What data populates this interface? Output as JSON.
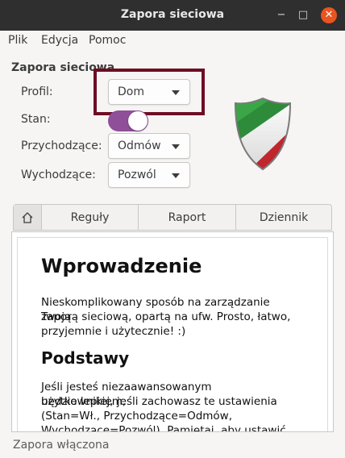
{
  "window": {
    "title": "Zapora sieciowa",
    "minimize": "−",
    "maximize": "□",
    "close": "✕"
  },
  "menu": {
    "file": "Plik",
    "edit": "Edycja",
    "help": "Pomoc"
  },
  "section": {
    "title": "Zapora sieciowa"
  },
  "form": {
    "profile_label": "Profil:",
    "profile_value": "Dom",
    "status_label": "Stan:",
    "status_on": true,
    "incoming_label": "Przychodzące:",
    "incoming_value": "Odmów",
    "outgoing_label": "Wychodzące:",
    "outgoing_value": "Pozwól"
  },
  "tabs": {
    "home_icon": "home-icon",
    "rules": "Reguły",
    "report": "Raport",
    "log": "Dziennik"
  },
  "content": {
    "heading": "Wprowadzenie",
    "intro_line1": "Nieskomplikowany sposób na zarządzanie Twoją",
    "intro_line2": "zaporą sieciową, opartą na ufw. Prosto, łatwo,",
    "intro_line3": "przyjemnie i użytecznie! :)",
    "subheading": "Podstawy",
    "basics_line1": "Jeśli jesteś niezaawansowanym użytkownikiem,",
    "basics_line2": "będzie lepiej, jeśli zachowasz te ustawienia",
    "basics_line3": "(Stan=Wł., Przychodzące=Odmów,",
    "basics_line4": "Wychodzące=Pozwól). Pamiętaj, aby ustawić"
  },
  "status": {
    "text": "Zapora włączona"
  },
  "colors": {
    "switch_on": "#8f4f99",
    "highlight": "#6e0d22",
    "close_button": "#e95420"
  }
}
